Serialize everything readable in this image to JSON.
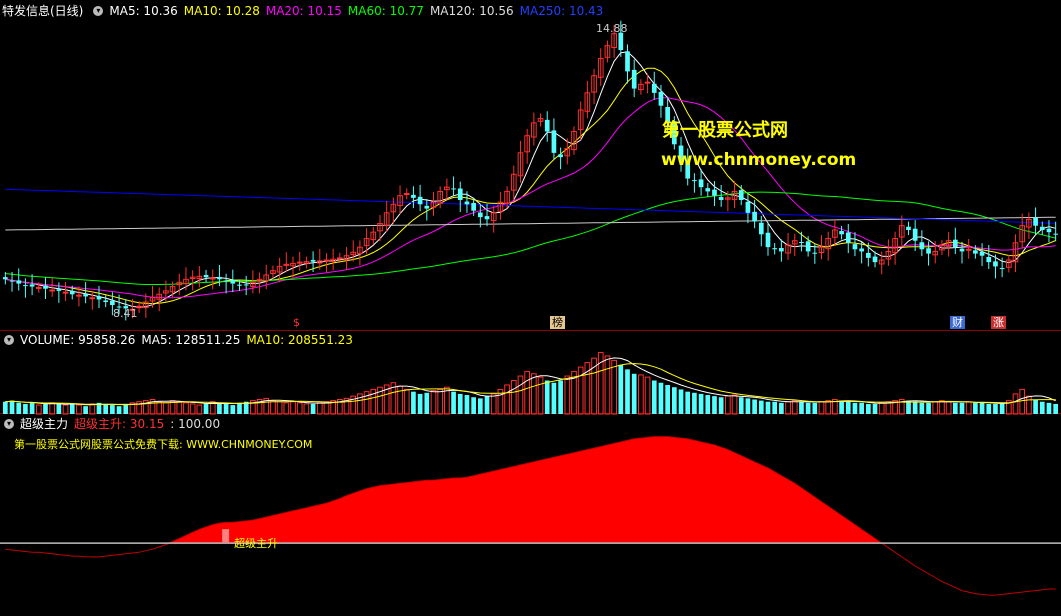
{
  "colors": {
    "bg": "#000000",
    "up": "#ff3030",
    "down": "#54ffff",
    "ma5": "#ffffff",
    "ma10": "#ffff00",
    "ma20": "#ff00ff",
    "ma60": "#00ff00",
    "ma120": "#cccccc",
    "ma250": "#0000ff",
    "signal": "#ff0000",
    "baseline": "#c0c0c0"
  },
  "header": {
    "title": "特发信息(日线)",
    "ma5": "MA5: 10.36",
    "ma10": "MA10: 10.28",
    "ma20": "MA20: 10.15",
    "ma60": "MA60: 10.77",
    "ma120": "MA120: 10.56",
    "ma250": "MA250: 10.43"
  },
  "price_panel": {
    "high_label": "14.88",
    "low_label": "8.41",
    "markers": [
      "$",
      "榜",
      "财",
      "涨"
    ]
  },
  "watermark": {
    "line1": "第一股票公式网",
    "line2": "www.chnmoney.com"
  },
  "volume_panel": {
    "vol": "VOLUME: 95858.26",
    "ma5": "MA5: 128511.25",
    "ma10": "MA10: 208551.23"
  },
  "indicator_panel": {
    "name": "超级主力",
    "value": "超级主升: 30.15",
    "ref": ": 100.00",
    "promo": "第一股票公式网股票公式免费下载: WWW.CHNMONEY.COM",
    "signal_label": "超级主升"
  },
  "chart_data": [
    {
      "type": "candlestick",
      "title": "特发信息(日线)",
      "ylim": [
        8.2,
        15.2
      ],
      "closes": [
        9.15,
        9.1,
        9.05,
        9.0,
        8.98,
        8.96,
        8.93,
        8.9,
        8.88,
        8.85,
        8.8,
        8.78,
        8.75,
        8.72,
        8.68,
        8.62,
        8.55,
        8.5,
        8.47,
        8.45,
        8.52,
        8.62,
        8.72,
        8.8,
        8.88,
        8.98,
        9.08,
        9.15,
        9.2,
        9.22,
        9.2,
        9.18,
        9.15,
        9.1,
        9.05,
        9.0,
        9.02,
        9.08,
        9.15,
        9.25,
        9.35,
        9.45,
        9.5,
        9.52,
        9.55,
        9.56,
        9.56,
        9.58,
        9.6,
        9.62,
        9.65,
        9.7,
        9.78,
        9.9,
        10.1,
        10.25,
        10.45,
        10.7,
        10.9,
        11.1,
        11.15,
        11.05,
        10.9,
        10.8,
        10.95,
        11.2,
        11.3,
        11.25,
        11.0,
        10.9,
        10.75,
        10.6,
        10.55,
        10.7,
        10.95,
        11.2,
        11.6,
        12.1,
        12.5,
        12.8,
        12.9,
        12.6,
        12.1,
        12.0,
        12.2,
        12.6,
        13.1,
        13.5,
        13.9,
        14.3,
        14.6,
        14.88,
        14.5,
        14.0,
        13.6,
        13.7,
        13.75,
        13.5,
        13.2,
        12.8,
        12.3,
        11.9,
        11.5,
        11.45,
        11.3,
        11.2,
        11.1,
        11.0,
        11.05,
        11.2,
        11.0,
        10.7,
        10.5,
        10.2,
        9.9,
        9.85,
        9.8,
        9.95,
        10.05,
        10.0,
        9.8,
        9.75,
        9.9,
        10.1,
        10.3,
        10.2,
        10.0,
        9.85,
        9.8,
        9.65,
        9.55,
        9.6,
        9.8,
        10.1,
        10.4,
        10.3,
        10.05,
        9.85,
        9.75,
        9.8,
        9.95,
        10.05,
        9.9,
        9.8,
        9.85,
        9.75,
        9.7,
        9.55,
        9.45,
        9.4,
        9.6,
        10.0,
        10.4,
        10.55,
        10.4,
        10.3,
        10.25,
        10.2
      ],
      "open_offsets": [
        0.06,
        -0.05,
        0.04,
        -0.06,
        0.05,
        -0.04,
        0.07,
        -0.05,
        0.03,
        -0.06,
        0.05,
        -0.07,
        0.04,
        -0.05,
        0.06,
        -0.04,
        0.05,
        -0.06,
        0.04,
        -0.05
      ],
      "high_label": "14.88",
      "low_label": "8.41"
    },
    {
      "type": "bar",
      "title": "VOLUME",
      "values": [
        11,
        12,
        10,
        9,
        10,
        8,
        9,
        10,
        9,
        8,
        9,
        8,
        7,
        9,
        10,
        9,
        8,
        7,
        9,
        10,
        11,
        12,
        13,
        11,
        10,
        12,
        11,
        10,
        9,
        8,
        9,
        11,
        10,
        9,
        8,
        10,
        11,
        12,
        13,
        14,
        12,
        11,
        10,
        11,
        10,
        9,
        9,
        10,
        11,
        12,
        13,
        14,
        16,
        18,
        20,
        22,
        24,
        26,
        28,
        25,
        22,
        20,
        18,
        19,
        21,
        22,
        24,
        20,
        18,
        17,
        15,
        14,
        16,
        18,
        22,
        26,
        30,
        34,
        38,
        36,
        33,
        30,
        28,
        30,
        34,
        38,
        42,
        46,
        50,
        55,
        52,
        48,
        44,
        40,
        36,
        35,
        33,
        30,
        28,
        26,
        24,
        22,
        20,
        19,
        18,
        17,
        16,
        15,
        16,
        17,
        15,
        14,
        13,
        12,
        11,
        11,
        10,
        11,
        12,
        11,
        10,
        10,
        11,
        12,
        13,
        12,
        11,
        10,
        10,
        9,
        9,
        10,
        11,
        12,
        13,
        12,
        11,
        10,
        10,
        11,
        12,
        11,
        10,
        10,
        11,
        10,
        10,
        9,
        9,
        9,
        12,
        18,
        22,
        16,
        13,
        11,
        10,
        9
      ],
      "ylim": [
        0,
        60
      ]
    },
    {
      "type": "area",
      "title": "超级主力",
      "values": [
        -8,
        -9,
        -10,
        -11,
        -12,
        -12,
        -13,
        -14,
        -15,
        -16,
        -17,
        -17,
        -18,
        -18,
        -18,
        -17,
        -16,
        -15,
        -14,
        -13,
        -12,
        -10,
        -8,
        -5,
        -2,
        2,
        6,
        10,
        14,
        18,
        21,
        24,
        26,
        27,
        27,
        28,
        29,
        30,
        32,
        34,
        36,
        38,
        40,
        42,
        44,
        46,
        48,
        50,
        52,
        55,
        58,
        62,
        65,
        68,
        71,
        73,
        75,
        76,
        77,
        78,
        79,
        80,
        81,
        82,
        82,
        83,
        84,
        85,
        85,
        86,
        88,
        90,
        92,
        94,
        96,
        98,
        100,
        102,
        104,
        106,
        108,
        110,
        112,
        114,
        116,
        118,
        120,
        122,
        124,
        126,
        128,
        130,
        132,
        134,
        136,
        137,
        138,
        139,
        139,
        139,
        138,
        137,
        136,
        134,
        132,
        130,
        128,
        125,
        122,
        118,
        114,
        110,
        106,
        102,
        98,
        93,
        88,
        83,
        78,
        72,
        66,
        60,
        54,
        48,
        42,
        36,
        30,
        24,
        18,
        12,
        6,
        0,
        -6,
        -12,
        -18,
        -24,
        -30,
        -35,
        -40,
        -45,
        -50,
        -54,
        -58,
        -62,
        -64,
        -66,
        -67,
        -68,
        -68,
        -67,
        -66,
        -65,
        -64,
        -63,
        -62,
        -61,
        -60,
        -60,
        -59,
        -58,
        -57,
        -56,
        -55,
        -54,
        -53,
        -52,
        -51
      ],
      "baseline": 0,
      "ylim": [
        -90,
        145
      ],
      "signal_index": 33
    }
  ]
}
